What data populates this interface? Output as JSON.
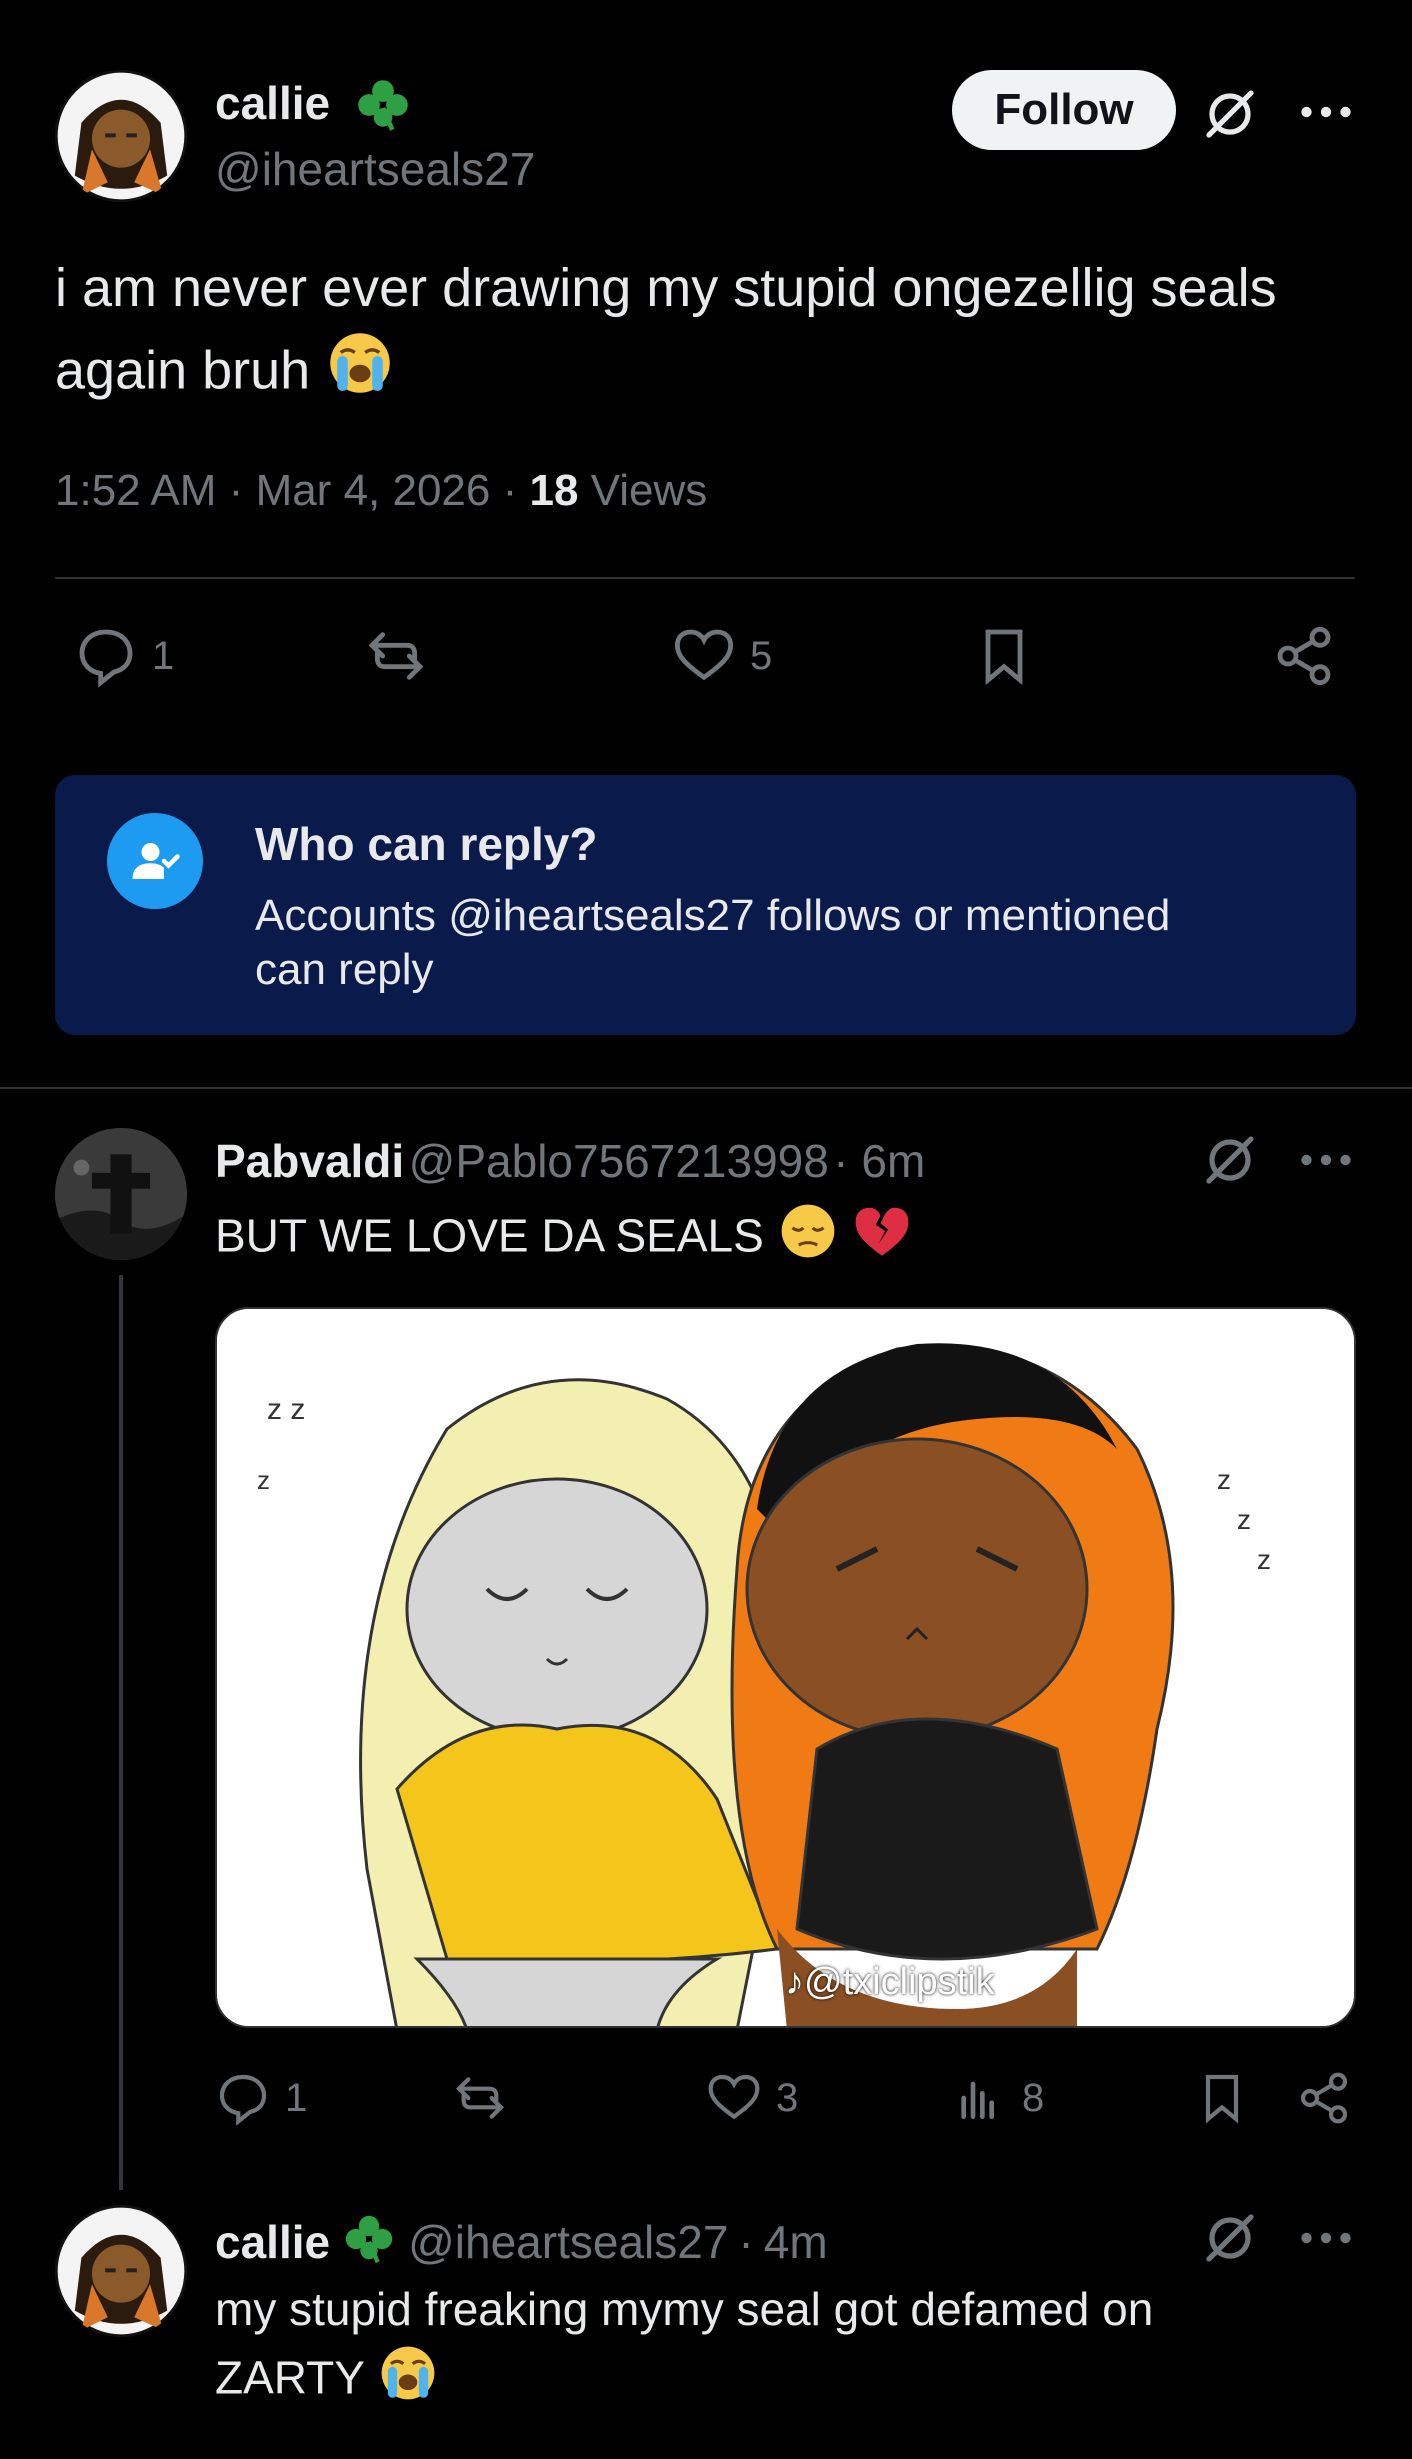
{
  "tweet": {
    "author": {
      "name": "callie",
      "handle": "@iheartseals27",
      "badge_icon": "clover-icon"
    },
    "follow_label": "Follow",
    "text": "i am never ever drawing my stupid ongezellig seals again bruh",
    "text_emoji": "loudly-crying-face",
    "time": "1:52 AM",
    "date": "Mar 4, 2026",
    "views_count": "18",
    "views_label": "Views",
    "actions": {
      "replies": "1",
      "likes": "5"
    }
  },
  "reply_restriction": {
    "title": "Who can reply?",
    "description_line1": "Accounts @iheartseals27 follows or mentioned",
    "description_line2": "can reply"
  },
  "replies": [
    {
      "name": "Pabvaldi",
      "handle": "@Pablo7567213998",
      "time": "6m",
      "text": "BUT WE LOVE DA SEALS",
      "emojis": [
        "pensive-face",
        "broken-heart"
      ],
      "media_watermark": "@txiclipstik",
      "actions": {
        "replies": "1",
        "likes": "3",
        "views": "8"
      }
    },
    {
      "name": "callie",
      "handle": "@iheartseals27",
      "time": "4m",
      "badge_icon": "clover-icon",
      "text_line1": "my stupid freaking mymy seal got defamed on",
      "text_line2": "ZARTY",
      "emoji": "loudly-crying-face"
    }
  ],
  "colors": {
    "background": "#000000",
    "text": "#e7e9ea",
    "muted": "#71767b",
    "divider": "#2f3336",
    "reply_box": "#0a1a4a",
    "accent_blue": "#1d9bf0",
    "clover_green": "#2ea043"
  }
}
